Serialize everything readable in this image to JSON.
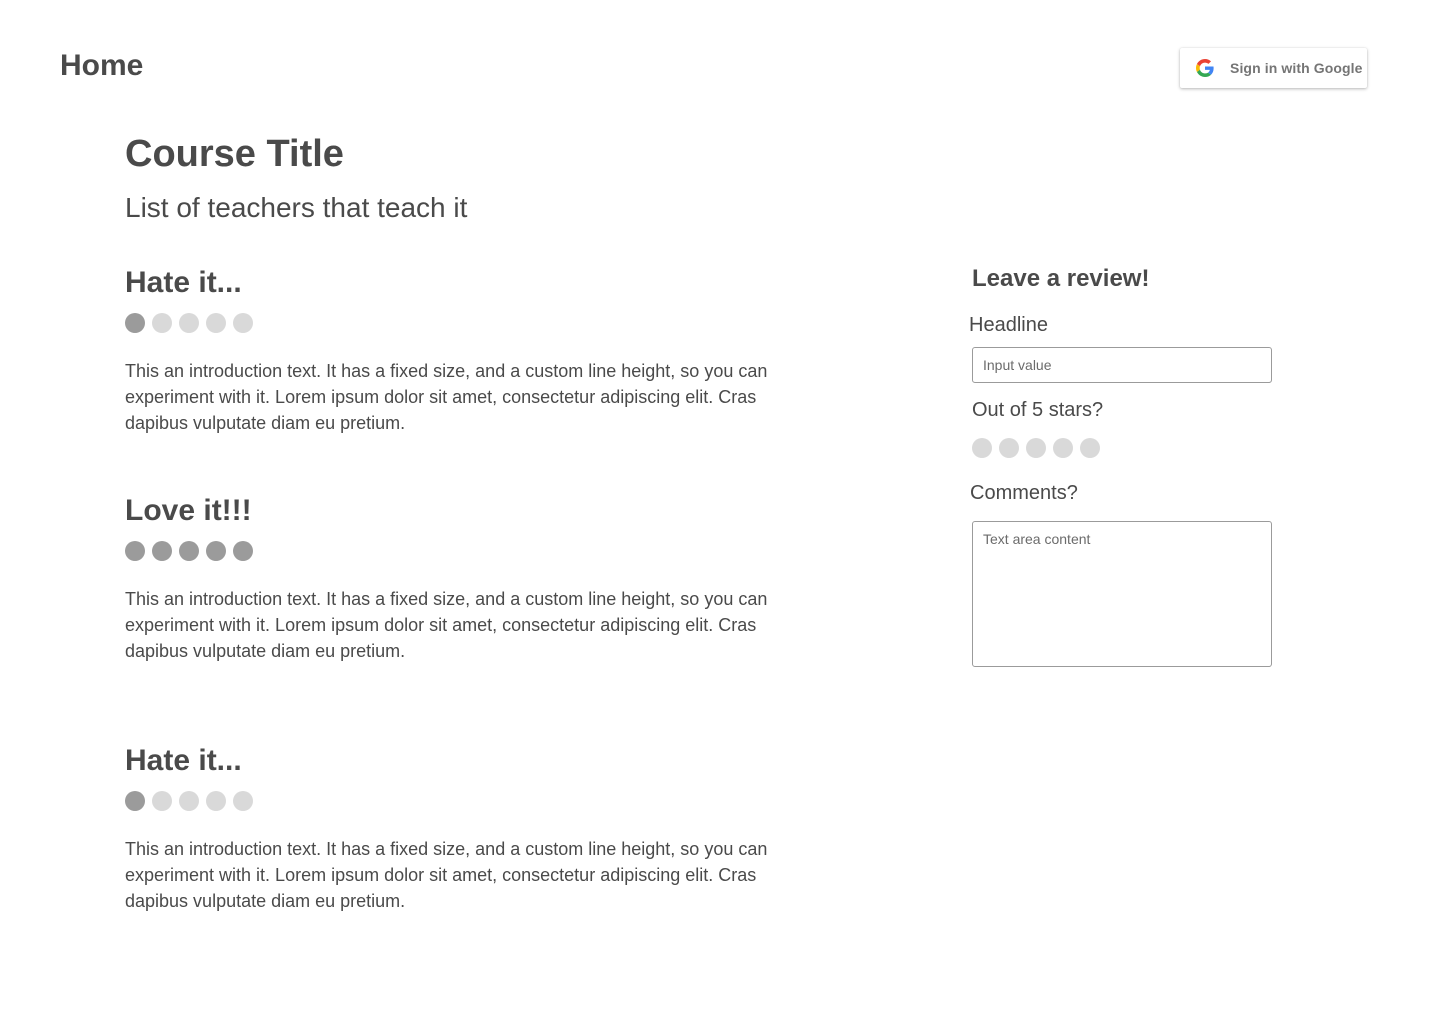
{
  "header": {
    "home_label": "Home",
    "google_button": {
      "label": "Sign in with Google",
      "icon": "google-g-icon"
    }
  },
  "course": {
    "title": "Course Title",
    "teachers": "List of teachers that teach it"
  },
  "reviews": [
    {
      "headline": "Hate it...",
      "rating": 1,
      "max_rating": 5,
      "body": "This an introduction text. It has a fixed size, and a custom line height, so you can experiment with it. Lorem ipsum dolor sit amet, consectetur adipiscing elit. Cras dapibus vulputate diam eu pretium."
    },
    {
      "headline": "Love it!!!",
      "rating": 5,
      "max_rating": 5,
      "body": "This an introduction text. It has a fixed size, and a custom line height, so you can experiment with it. Lorem ipsum dolor sit amet, consectetur adipiscing elit. Cras dapibus vulputate diam eu pretium."
    },
    {
      "headline": "Hate it...",
      "rating": 1,
      "max_rating": 5,
      "body": "This an introduction text. It has a fixed size, and a custom line height, so you can experiment with it. Lorem ipsum dolor sit amet, consectetur adipiscing elit. Cras dapibus vulputate diam eu pretium."
    }
  ],
  "review_form": {
    "title": "Leave a review!",
    "headline_label": "Headline",
    "headline_placeholder": "Input value",
    "stars_label": "Out of 5 stars?",
    "stars_value": 0,
    "stars_max": 5,
    "comments_label": "Comments?",
    "comments_placeholder": "Text area content"
  },
  "colors": {
    "text": "#4a4a4a",
    "star_filled": "#9b9b9b",
    "star_empty": "#d9d9d9",
    "input_border": "#9b9b9b"
  }
}
